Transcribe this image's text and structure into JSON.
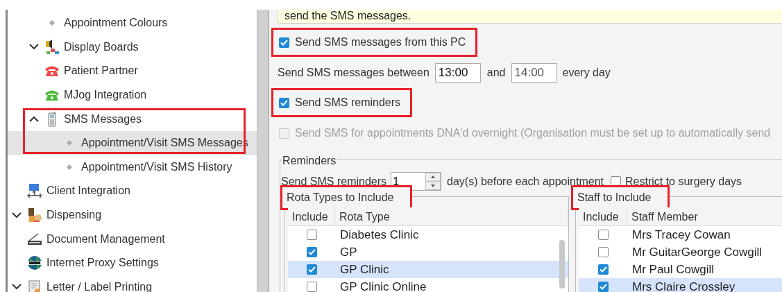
{
  "tree": [
    {
      "children": [
        {
          "label": "Appointment Colours",
          "kind": "bullet"
        },
        {
          "label": "Display Boards",
          "kind": "display",
          "expanded": false
        },
        {
          "label": "Patient Partner",
          "kind": "phone",
          "color": "#f04848"
        },
        {
          "label": "MJog Integration",
          "kind": "phone",
          "color": "#4cbb3a"
        },
        {
          "label": "SMS Messages",
          "kind": "mobile",
          "expanded": true,
          "highlighted": true,
          "children": [
            {
              "label": "Appointment/Visit SMS Messages",
              "kind": "bullet",
              "selected": true
            },
            {
              "label": "Appointment/Visit SMS History",
              "kind": "bullet",
              "selected": false
            }
          ]
        }
      ]
    },
    {
      "label": "Client Integration",
      "kind": "computer"
    },
    {
      "label": "Dispensing",
      "kind": "dispensing",
      "expanded": false
    },
    {
      "label": "Document Management",
      "kind": "scanner"
    },
    {
      "label": "Internet Proxy Settings",
      "kind": "globe"
    },
    {
      "label": "Letter / Label Printing",
      "kind": "letter",
      "expanded": false
    }
  ],
  "notice": "send the SMS messages.",
  "send_from_pc": {
    "label": "Send SMS messages from this PC",
    "checked": true,
    "highlighted": true
  },
  "time_window": {
    "label": "Send SMS messages between",
    "from": "13:00",
    "joiner": "and",
    "to": "14:00",
    "suffix": "every day"
  },
  "send_reminders": {
    "label": "Send SMS reminders",
    "checked": true,
    "highlighted": true
  },
  "dna_overnight": {
    "label": "Send SMS for appointments DNA'd overnight (Organisation must be set up to automatically send",
    "checked": false,
    "disabled": true
  },
  "reminders": {
    "title": "Reminders",
    "days_label": "Send SMS reminders",
    "days": "1",
    "days_suffix": "day(s) before each appointment",
    "restrict": {
      "label": "Restrict to surgery days",
      "checked": false
    },
    "rota_types": {
      "title": "Rota Types to Include",
      "highlighted": true,
      "columns": [
        "Include",
        "Rota Type"
      ],
      "rows": [
        {
          "label": "Diabetes Clinic",
          "included": false,
          "selected": false
        },
        {
          "label": "GP",
          "included": true,
          "selected": false
        },
        {
          "label": "GP Clinic",
          "included": true,
          "selected": true
        },
        {
          "label": "GP Clinic Online",
          "included": false,
          "selected": false
        }
      ]
    },
    "staff": {
      "title": "Staff to Include",
      "highlighted": true,
      "columns": [
        "Include",
        "Staff Member"
      ],
      "rows": [
        {
          "label": "Mrs Tracey Cowan",
          "included": false,
          "selected": false
        },
        {
          "label": "Mr GuitarGeorge Cowgill",
          "included": false,
          "selected": false
        },
        {
          "label": "Mr Paul Cowgill",
          "included": true,
          "selected": false
        },
        {
          "label": "Mrs Claire Crossley",
          "included": true,
          "selected": true
        }
      ]
    }
  }
}
